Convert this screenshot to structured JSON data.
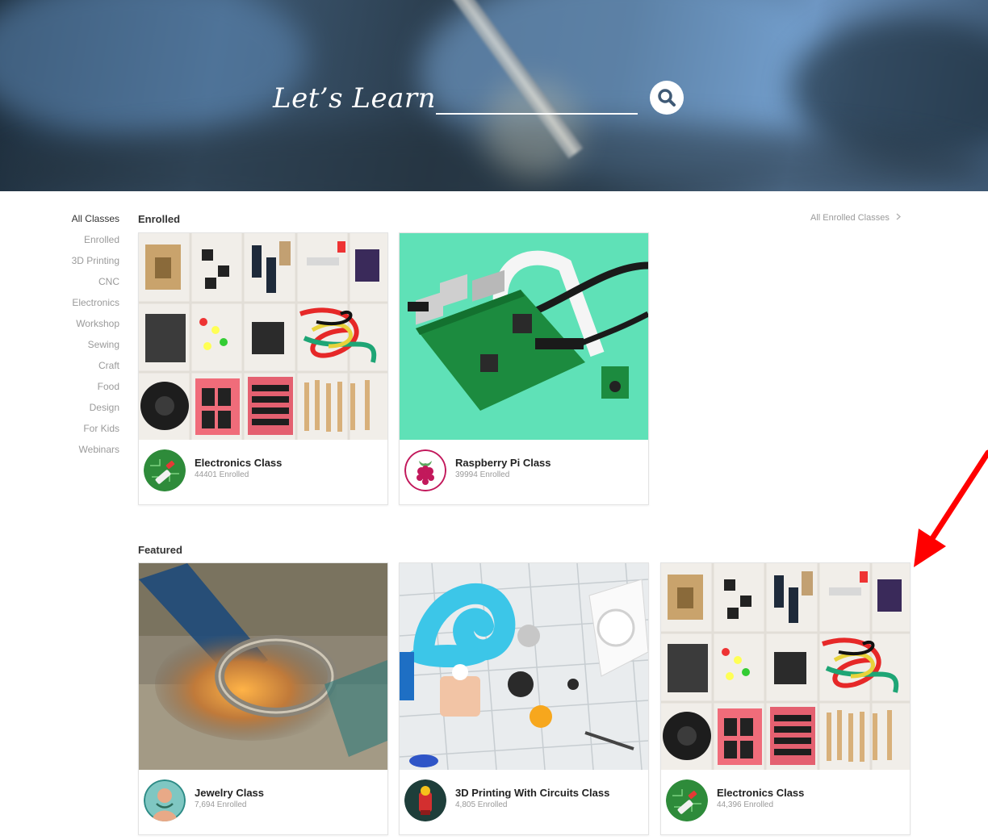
{
  "hero": {
    "title": "Let’s Learn",
    "search_value": "",
    "search_icon": "search-icon"
  },
  "sidebar": {
    "items": [
      {
        "label": "All Classes",
        "active": true
      },
      {
        "label": "Enrolled"
      },
      {
        "label": "3D Printing"
      },
      {
        "label": "CNC"
      },
      {
        "label": "Electronics"
      },
      {
        "label": "Workshop"
      },
      {
        "label": "Sewing"
      },
      {
        "label": "Craft"
      },
      {
        "label": "Food"
      },
      {
        "label": "Design"
      },
      {
        "label": "For Kids"
      },
      {
        "label": "Webinars"
      }
    ]
  },
  "enrolled": {
    "heading": "Enrolled",
    "all_link": "All Enrolled Classes",
    "link_icon": "chevron-right-icon",
    "cards": [
      {
        "title": "Electronics Class",
        "enrolled": "44401 Enrolled",
        "image": "electronics-components-image",
        "avatar": "electronics-class-icon"
      },
      {
        "title": "Raspberry Pi Class",
        "enrolled": "39994 Enrolled",
        "image": "raspberry-pi-board-image",
        "avatar": "raspberry-pi-icon"
      }
    ]
  },
  "featured": {
    "heading": "Featured",
    "cards": [
      {
        "title": "Jewelry Class",
        "enrolled": "7,694 Enrolled",
        "image": "ring-casting-image",
        "avatar": "jewelry-class-icon"
      },
      {
        "title": "3D Printing With Circuits Class",
        "enrolled": "4,805 Enrolled",
        "image": "3d-printed-snail-image",
        "avatar": "3d-printing-circuits-icon"
      },
      {
        "title": "Electronics Class",
        "enrolled": "44,396 Enrolled",
        "image": "electronics-components-image",
        "avatar": "electronics-class-icon"
      }
    ]
  },
  "annotation": {
    "icon": "red-arrow-icon",
    "color": "#ff0000"
  },
  "colors": {
    "electronics_green": "#2e8b3a",
    "raspberry": "#c2185b",
    "mint": "#5fe1b7"
  }
}
